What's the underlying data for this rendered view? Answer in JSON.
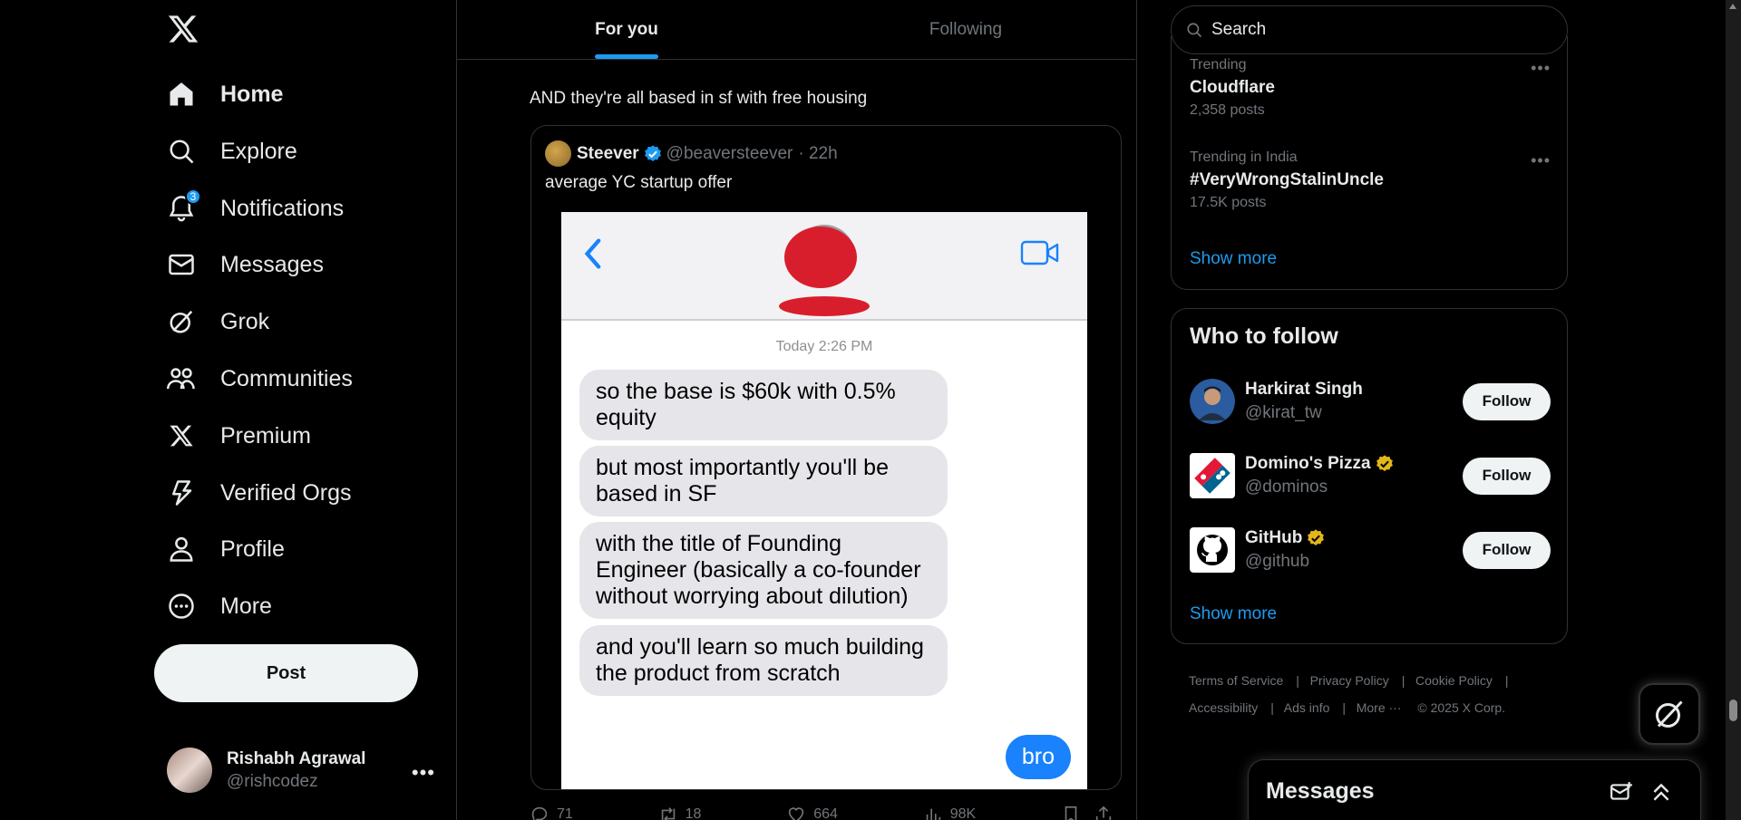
{
  "nav": {
    "logo_icon": "x-logo-icon",
    "items": [
      {
        "label": "Home",
        "icon": "home-icon"
      },
      {
        "label": "Explore",
        "icon": "search-icon"
      },
      {
        "label": "Notifications",
        "icon": "bell-icon",
        "badge": "3"
      },
      {
        "label": "Messages",
        "icon": "envelope-icon"
      },
      {
        "label": "Grok",
        "icon": "grok-icon"
      },
      {
        "label": "Communities",
        "icon": "people-icon"
      },
      {
        "label": "Premium",
        "icon": "x-logo-icon"
      },
      {
        "label": "Verified Orgs",
        "icon": "lightning-icon"
      },
      {
        "label": "Profile",
        "icon": "person-icon"
      },
      {
        "label": "More",
        "icon": "more-circle-icon"
      }
    ],
    "post_label": "Post",
    "account": {
      "name": "Rishabh Agrawal",
      "handle": "@rishcodez"
    }
  },
  "tabs": [
    {
      "label": "For you"
    },
    {
      "label": "Following"
    }
  ],
  "tweet": {
    "text": "AND they're all based in sf with free housing",
    "quote": {
      "name": "Steever",
      "handle": "@beaversteever",
      "time": "· 22h",
      "text": "average YC startup offer",
      "image": {
        "timestamp": "Today 2:26 PM",
        "messages": [
          "so the base is $60k with 0.5% equity",
          "but most importantly you'll be based in SF",
          "with the title of Founding Engineer (basically a co-founder without worrying about dilution)",
          "and you'll learn so much building the product from scratch"
        ],
        "reply": "bro"
      }
    },
    "actions": {
      "replies": "71",
      "reposts": "18",
      "likes": "664",
      "views": "98K"
    }
  },
  "right": {
    "search_placeholder": "Search",
    "trends": [
      {
        "context": "Trending",
        "name": "Cloudflare",
        "count": "2,358 posts"
      },
      {
        "context": "Trending in India",
        "name": "#VeryWrongStalinUncle",
        "count": "17.5K posts"
      }
    ],
    "trends_show_more": "Show more",
    "who_to_follow": {
      "title": "Who to follow",
      "accounts": [
        {
          "name": "Harkirat Singh",
          "handle": "@kirat_tw",
          "verified": false
        },
        {
          "name": "Domino's Pizza",
          "handle": "@dominos",
          "verified": true
        },
        {
          "name": "GitHub",
          "handle": "@github",
          "verified": true
        }
      ],
      "follow_label": "Follow",
      "show_more": "Show more"
    },
    "footer": {
      "links": [
        "Terms of Service",
        "Privacy Policy",
        "Cookie Policy",
        "Accessibility",
        "Ads info",
        "More ···"
      ],
      "copyright": "© 2025 X Corp."
    }
  },
  "messages_drawer": {
    "title": "Messages"
  },
  "colors": {
    "accent": "#1d9bf0",
    "gold": "#e2b719",
    "imessage_blue": "#1982fc"
  }
}
